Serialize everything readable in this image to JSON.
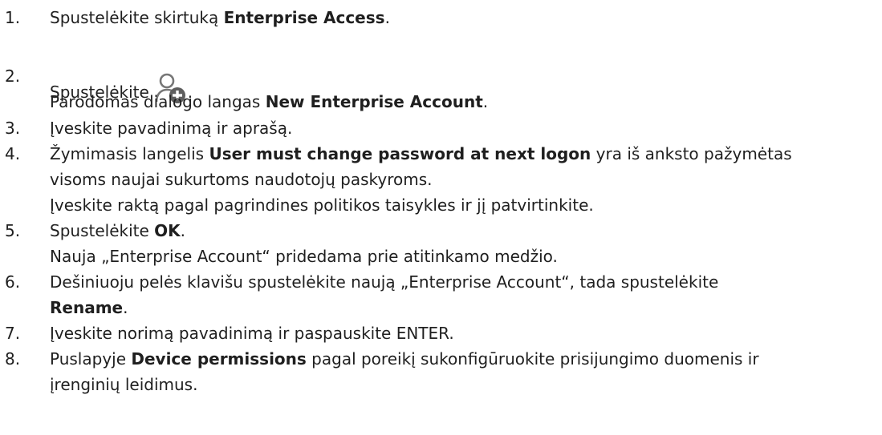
{
  "steps": [
    {
      "num": "1.",
      "lines": [
        {
          "parts": [
            {
              "t": "Spustelėkite skirtuką "
            },
            {
              "t": "Enterprise Access",
              "b": true
            },
            {
              "t": "."
            }
          ]
        }
      ]
    },
    {
      "num": "2.",
      "icon": "add-user-icon",
      "lines": [
        {
          "parts": [
            {
              "t": "Spustelėkite"
            }
          ]
        },
        {
          "parts": [
            {
              "t": "Parodomas dialogo langas "
            },
            {
              "t": "New Enterprise Account",
              "b": true
            },
            {
              "t": "."
            }
          ]
        }
      ]
    },
    {
      "num": "3.",
      "lines": [
        {
          "parts": [
            {
              "t": "Įveskite pavadinimą ir aprašą."
            }
          ]
        }
      ]
    },
    {
      "num": "4.",
      "lines": [
        {
          "parts": [
            {
              "t": "Žymimasis langelis "
            },
            {
              "t": "User must change password at next logon",
              "b": true
            },
            {
              "t": " yra iš anksto pažymėtas"
            }
          ]
        },
        {
          "parts": [
            {
              "t": "visoms naujai sukurtoms naudotojų paskyroms."
            }
          ]
        },
        {
          "parts": [
            {
              "t": "Įveskite raktą pagal pagrindines politikos taisykles ir jį patvirtinkite."
            }
          ]
        }
      ]
    },
    {
      "num": "5.",
      "lines": [
        {
          "parts": [
            {
              "t": "Spustelėkite "
            },
            {
              "t": "OK",
              "b": true
            },
            {
              "t": "."
            }
          ]
        },
        {
          "parts": [
            {
              "t": "Nauja „Enterprise Account“ pridedama prie atitinkamo medžio."
            }
          ]
        }
      ]
    },
    {
      "num": "6.",
      "lines": [
        {
          "parts": [
            {
              "t": "Dešiniuoju pelės klavišu spustelėkite naują „Enterprise Account“, tada spustelėkite"
            }
          ]
        },
        {
          "parts": [
            {
              "t": "Rename",
              "b": true
            },
            {
              "t": "."
            }
          ]
        }
      ]
    },
    {
      "num": "7.",
      "lines": [
        {
          "parts": [
            {
              "t": "Įveskite norimą pavadinimą ir paspauskite ENTER."
            }
          ]
        }
      ]
    },
    {
      "num": "8.",
      "lines": [
        {
          "parts": [
            {
              "t": "Puslapyje "
            },
            {
              "t": "Device permissions",
              "b": true
            },
            {
              "t": " pagal poreikį sukonfigūruokite prisijungimo duomenis ir"
            }
          ]
        },
        {
          "parts": [
            {
              "t": "įrenginių leidimus."
            }
          ]
        }
      ]
    }
  ]
}
